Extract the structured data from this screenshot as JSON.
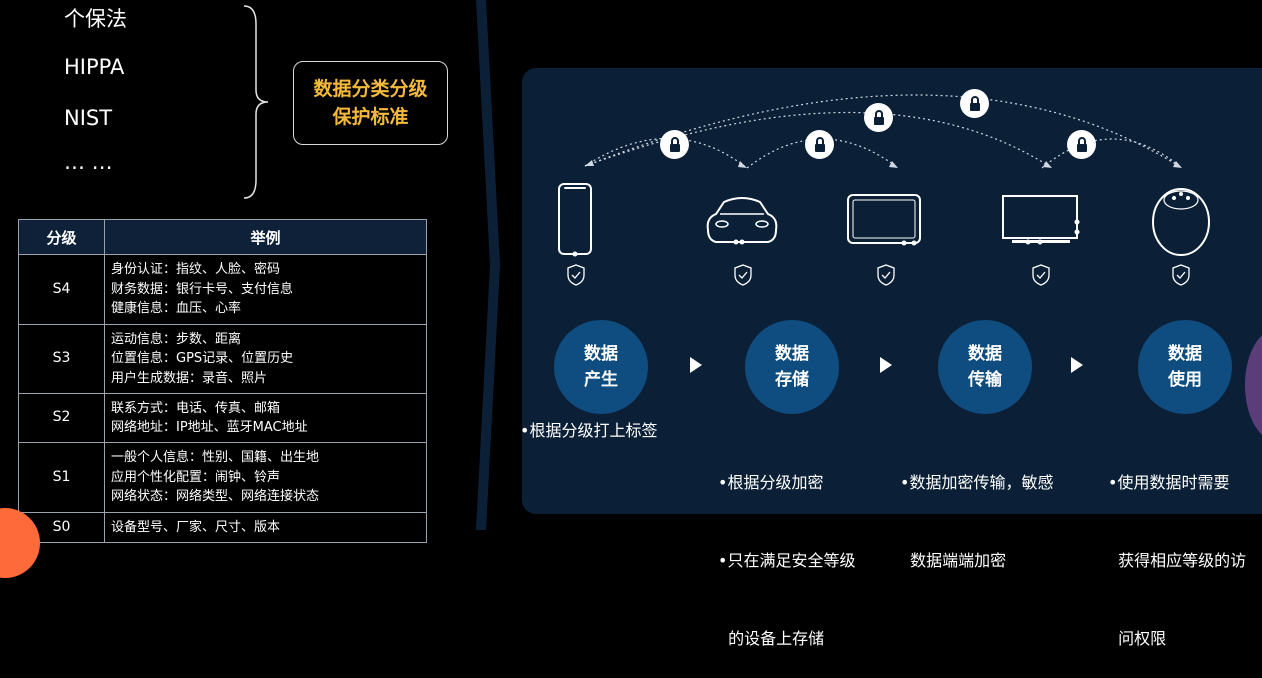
{
  "standards": [
    "个保法",
    "HIPPA",
    "NIST",
    "… …"
  ],
  "badge": {
    "line1": "数据分类分级",
    "line2": "保护标准"
  },
  "table": {
    "headers": [
      "分级",
      "举例"
    ],
    "rows": [
      {
        "level": "S4",
        "lines": [
          "身份认证：指纹、人脸、密码",
          "财务数据：银行卡号、支付信息",
          "健康信息：血压、心率"
        ]
      },
      {
        "level": "S3",
        "lines": [
          "运动信息：步数、距离",
          "位置信息：GPS记录、位置历史",
          "用户生成数据：录音、照片"
        ]
      },
      {
        "level": "S2",
        "lines": [
          "联系方式：电话、传真、邮箱",
          "网络地址：IP地址、蓝牙MAC地址"
        ]
      },
      {
        "level": "S1",
        "lines": [
          "一般个人信息：性别、国籍、出生地",
          "应用个性化配置：闹钟、铃声",
          "网络状态：网络类型、网络连接状态"
        ]
      },
      {
        "level": "S0",
        "lines": [
          "设备型号、厂家、尺寸、版本"
        ]
      }
    ]
  },
  "devices": [
    "phone-icon",
    "car-icon",
    "tablet-icon",
    "monitor-icon",
    "smart-speaker-icon"
  ],
  "stages": [
    {
      "line1": "数据",
      "line2": "产生"
    },
    {
      "line1": "数据",
      "line2": "存储"
    },
    {
      "line1": "数据",
      "line2": "传输"
    },
    {
      "line1": "数据",
      "line2": "使用"
    }
  ],
  "descriptions": [
    [
      "•根据分级打上标签"
    ],
    [
      "•根据分级加密",
      "•只在满足安全等级",
      "  的设备上存储"
    ],
    [
      "•数据加密传输，敏感",
      "  数据端端加密"
    ],
    [
      "•使用数据时需要",
      "  获得相应等级的访",
      "  问权限"
    ]
  ],
  "colors": {
    "accent": "#f3b93a",
    "panel": "#0b2037",
    "stage": "#0f4c7f"
  }
}
